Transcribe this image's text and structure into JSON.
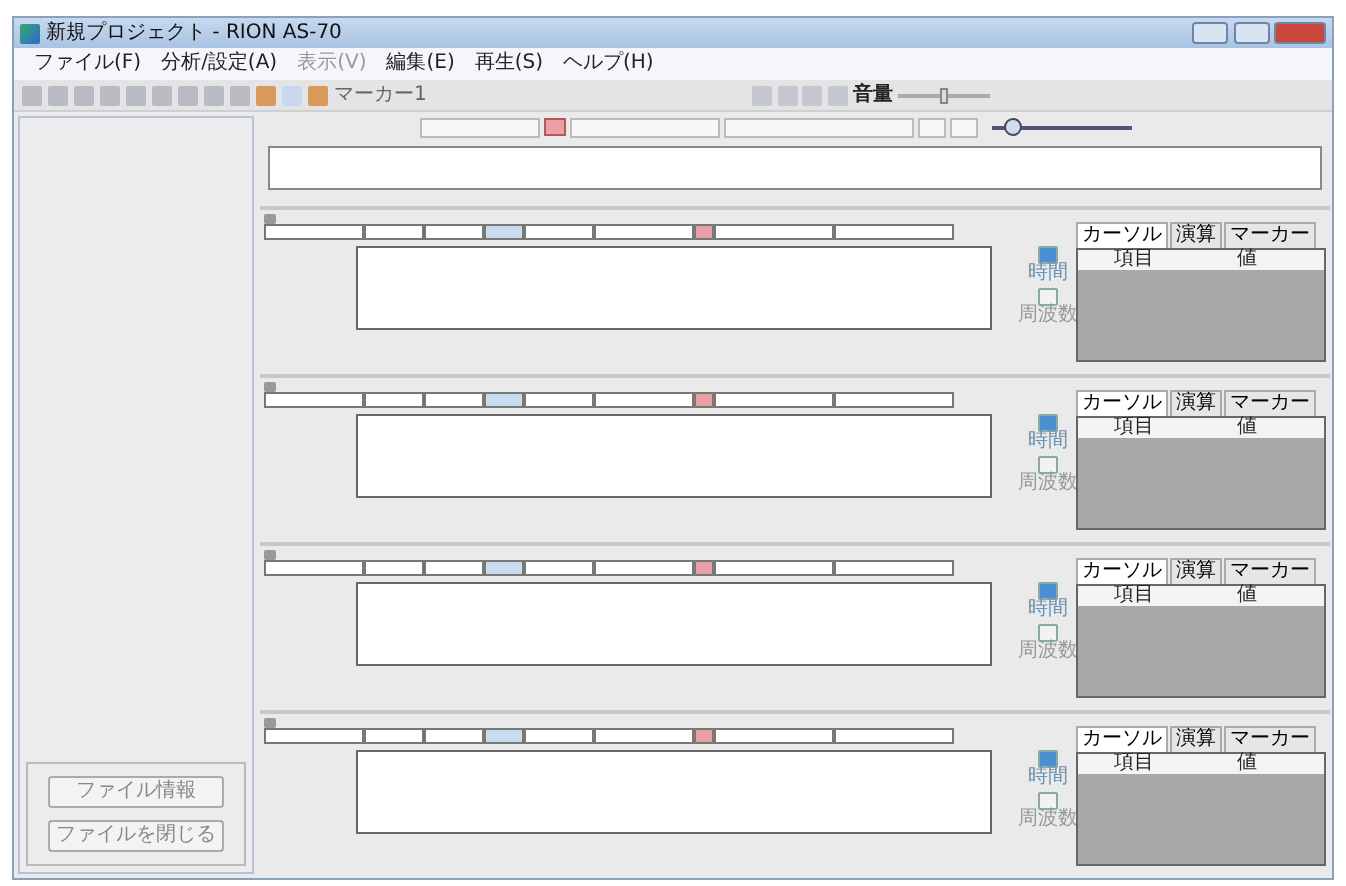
{
  "window": {
    "title": "新規プロジェクト - RION AS-70"
  },
  "menu": [
    {
      "label": "ファイル(F)",
      "disabled": false
    },
    {
      "label": "分析/設定(A)",
      "disabled": false
    },
    {
      "label": "表示(V)",
      "disabled": true
    },
    {
      "label": "編集(E)",
      "disabled": false
    },
    {
      "label": "再生(S)",
      "disabled": false
    },
    {
      "label": "ヘルプ(H)",
      "disabled": false
    }
  ],
  "toolbar": {
    "marker_label": "マーカー1",
    "volume_label": "音量",
    "volume": {
      "level": 0.5
    }
  },
  "zoom": {
    "level": 0.1
  },
  "sidebar": {
    "buttons": [
      "ファイル情報",
      "ファイルを閉じる"
    ]
  },
  "panels": [
    {
      "tool_buttons": [
        {
          "label": "時間",
          "selected": true
        },
        {
          "label": "周波数",
          "selected": false
        }
      ],
      "tabs": [
        {
          "label": "カーソル",
          "selected": true
        },
        {
          "label": "演算",
          "selected": false
        },
        {
          "label": "マーカー",
          "selected": false
        }
      ],
      "columns": [
        "項目",
        "値"
      ]
    },
    {
      "tool_buttons": [
        {
          "label": "時間",
          "selected": true
        },
        {
          "label": "周波数",
          "selected": false
        }
      ],
      "tabs": [
        {
          "label": "カーソル",
          "selected": true
        },
        {
          "label": "演算",
          "selected": false
        },
        {
          "label": "マーカー",
          "selected": false
        }
      ],
      "columns": [
        "項目",
        "値"
      ]
    },
    {
      "tool_buttons": [
        {
          "label": "時間",
          "selected": true
        },
        {
          "label": "周波数",
          "selected": false
        }
      ],
      "tabs": [
        {
          "label": "カーソル",
          "selected": true
        },
        {
          "label": "演算",
          "selected": false
        },
        {
          "label": "マーカー",
          "selected": false
        }
      ],
      "columns": [
        "項目",
        "値"
      ]
    },
    {
      "tool_buttons": [
        {
          "label": "時間",
          "selected": true
        },
        {
          "label": "周波数",
          "selected": false
        }
      ],
      "tabs": [
        {
          "label": "カーソル",
          "selected": true
        },
        {
          "label": "演算",
          "selected": false
        },
        {
          "label": "マーカー",
          "selected": false
        }
      ],
      "columns": [
        "項目",
        "値"
      ]
    }
  ]
}
